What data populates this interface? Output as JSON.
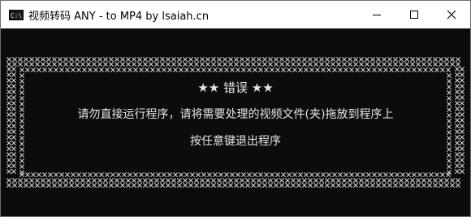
{
  "window": {
    "title": "视频转码 ANY - to MP4 by lsaiah.cn",
    "icon_label": "C:\\",
    "icon": "console-app-icon",
    "buttons": {
      "minimize": "minimize-icon",
      "maximize": "maximize-icon",
      "close": "close-icon"
    }
  },
  "console": {
    "heading": "★★ 错误 ★★",
    "message_line1": "请勿直接运行程序，请将需要处理的视频文件(夹)拖放到程序上",
    "message_line2": "按任意键退出程序",
    "border_glyph": "x-pattern"
  },
  "colors": {
    "console_bg": "#0c0c0c",
    "console_text": "#e6e6e6",
    "titlebar_bg": "#ffffff"
  }
}
